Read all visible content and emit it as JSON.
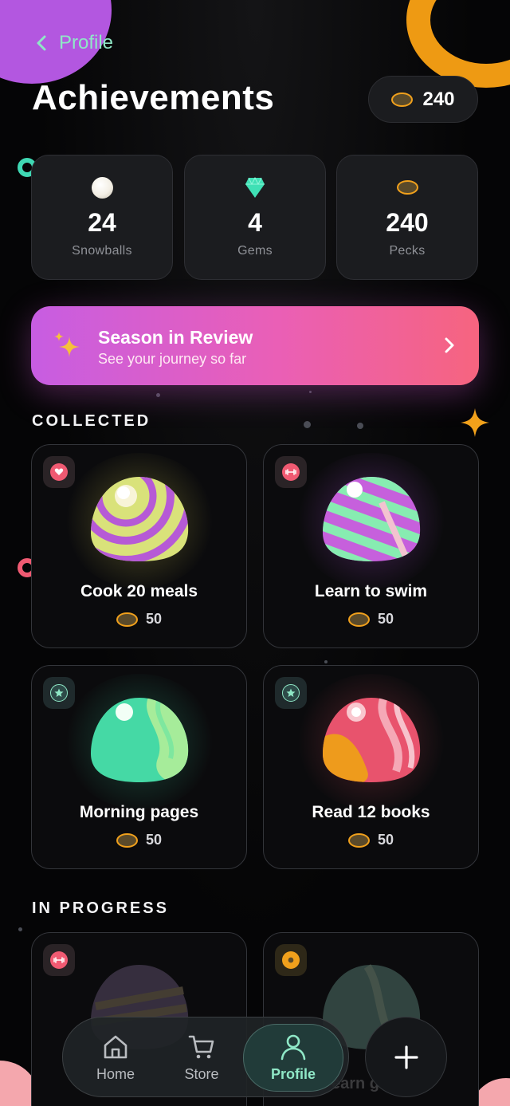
{
  "header": {
    "back_label": "Profile",
    "title": "Achievements",
    "coin_balance": "240"
  },
  "stats": [
    {
      "value": "24",
      "label": "Snowballs",
      "icon": "snowball-icon"
    },
    {
      "value": "4",
      "label": "Gems",
      "icon": "gem-icon"
    },
    {
      "value": "240",
      "label": "Pecks",
      "icon": "coin-icon"
    }
  ],
  "banner": {
    "title": "Season in Review",
    "subtitle": "See your journey so far",
    "icon": "sparkles-icon"
  },
  "sections": {
    "collected": "COLLECTED",
    "in_progress": "IN PROGRESS"
  },
  "collected": [
    {
      "title": "Cook 20 meals",
      "reward": "50",
      "badge": "heart-icon"
    },
    {
      "title": "Learn to swim",
      "reward": "50",
      "badge": "dumbbell-icon"
    },
    {
      "title": "Morning pages",
      "reward": "50",
      "badge": "star-icon"
    },
    {
      "title": "Read 12 books",
      "reward": "50",
      "badge": "star-icon"
    }
  ],
  "in_progress_partial": {
    "second_title_fragment": "earn g"
  },
  "nav": {
    "home": "Home",
    "store": "Store",
    "profile": "Profile"
  },
  "colors": {
    "accent": "#8fe7c6",
    "coin": "#f0a01c",
    "banner_start": "#c75de2",
    "banner_end": "#f6647f"
  }
}
